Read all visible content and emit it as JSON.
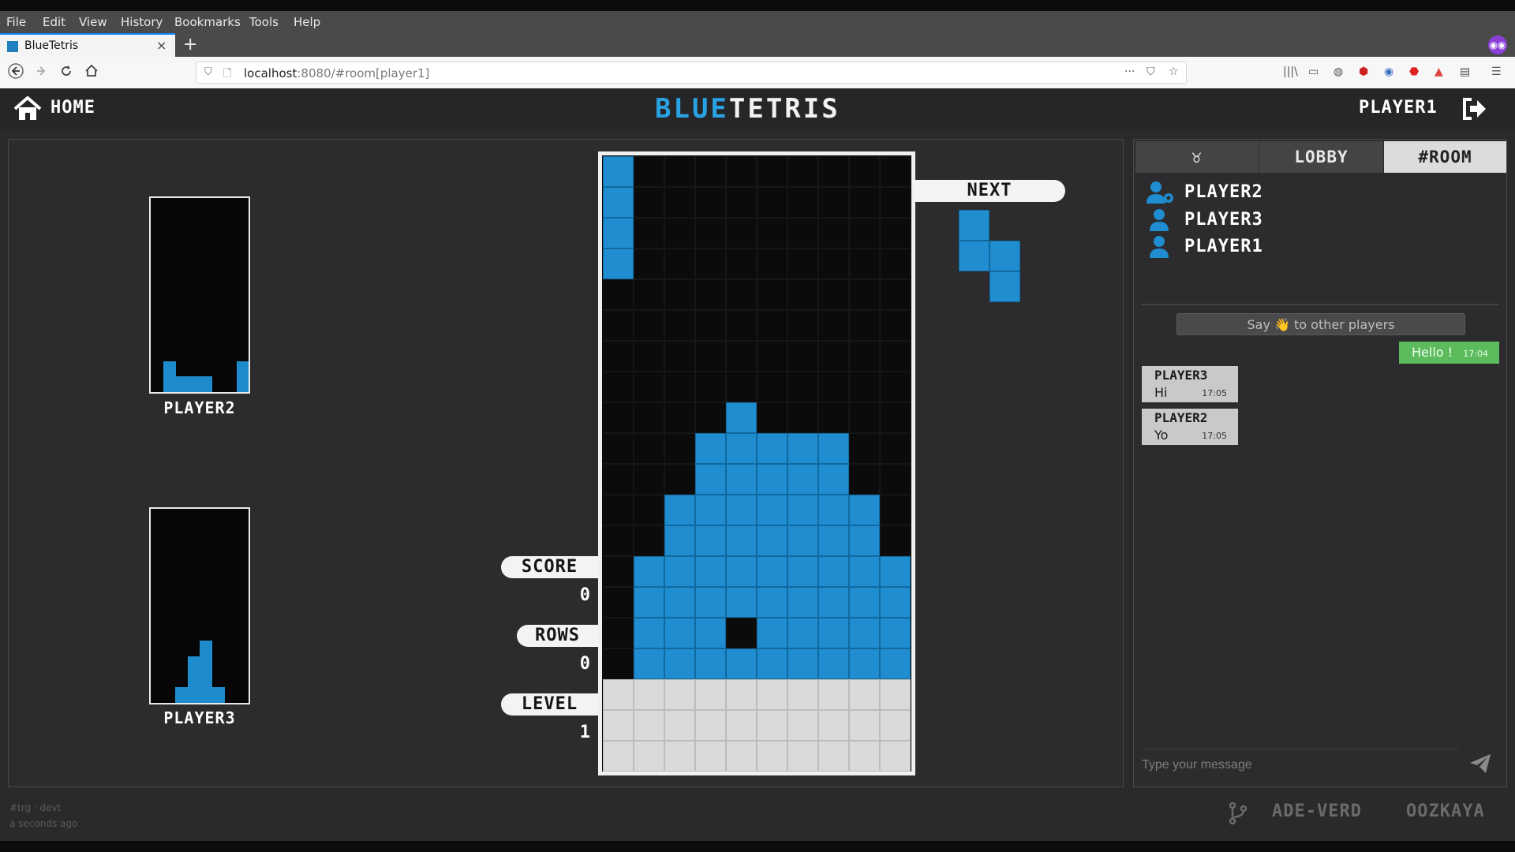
{
  "browser": {
    "menu": [
      "File",
      "Edit",
      "View",
      "History",
      "Bookmarks",
      "Tools",
      "Help"
    ],
    "tab_title": "BlueTetris",
    "tab_close": "×",
    "new_tab": "+",
    "url_host": "localhost",
    "url_rest": ":8080/#room[player1]",
    "page_actions": "···"
  },
  "header": {
    "home_label": "HOME",
    "brand_blue": "BLUE",
    "brand_white": "TETRIS",
    "username": "PLAYER1"
  },
  "opponents": [
    {
      "name": "PLAYER2",
      "heights_rows": [
        0,
        2,
        1,
        1,
        1,
        0,
        0,
        2
      ]
    },
    {
      "name": "PLAYER3",
      "heights_rows": [
        0,
        0,
        1,
        3,
        4,
        1,
        0,
        0
      ]
    }
  ],
  "stats": {
    "score_label": "SCORE",
    "score": "0",
    "rows_label": "ROWS",
    "rows": "0",
    "level_label": "LEVEL",
    "level": "1",
    "next_label": "NEXT"
  },
  "board": {
    "columns": 10,
    "rows": 20,
    "cells": [
      "X.........",
      "X.........",
      "X.........",
      "X.........",
      "..........",
      "..........",
      "..........",
      "..........",
      "....X.....",
      "...XXXXX..",
      "...XXXXX..",
      "..XXXXXXX.",
      "..XXXXXXX.",
      ".XXXXXXXXX",
      ".XXXXXXXXX",
      ".XXX.XXXXX",
      ".XXXXXXXXX",
      "GGGGGGGGGG",
      "GGGGGGGGGG",
      "GGGGGGGGGG"
    ]
  },
  "next_piece": [
    "X.",
    "XX",
    ".X"
  ],
  "chat": {
    "tabs": [
      {
        "label": "♉",
        "active": false
      },
      {
        "label": "LOBBY",
        "active": false
      },
      {
        "label": "#ROOM",
        "active": true
      }
    ],
    "players": [
      {
        "name": "PLAYER2",
        "icon": "user-gear-icon"
      },
      {
        "name": "PLAYER3",
        "icon": "user-icon"
      },
      {
        "name": "PLAYER1",
        "icon": "user-icon"
      }
    ],
    "say_hi_label": "Say 👋 to other players",
    "messages": [
      {
        "author": "",
        "text": "Hello !",
        "time": "17:04",
        "own": true
      },
      {
        "author": "PLAYER3",
        "text": "Hi",
        "time": "17:05",
        "own": false
      },
      {
        "author": "PLAYER2",
        "text": "Yo",
        "time": "17:05",
        "own": false
      }
    ],
    "input_placeholder": "Type your message"
  },
  "footer": {
    "line1": "#trg · devt",
    "line2": "a seconds ago",
    "authors": [
      "ADE-VERD",
      "OOZKAYA"
    ]
  },
  "colors": {
    "accent_blue": "#1f8dcf",
    "brand_blue": "#29a3e3",
    "own_message_green": "#5cbb5c"
  }
}
